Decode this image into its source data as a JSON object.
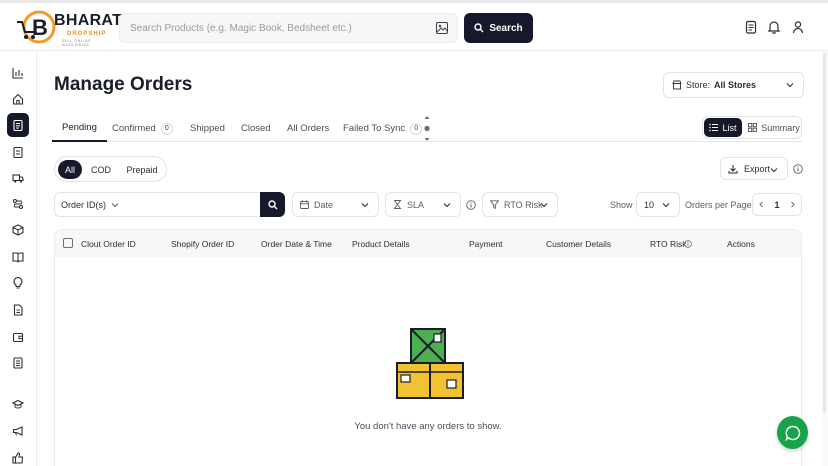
{
  "brand": {
    "name": "BHARAT",
    "sub": "DROPSHIP",
    "tag": "SELL ONLINE WORLDWIDE"
  },
  "search": {
    "placeholder": "Search Products (e.g. Magic Book, Bedsheet etc.)",
    "button_label": "Search"
  },
  "page": {
    "title": "Manage Orders"
  },
  "store": {
    "label": "Store:",
    "value": "All Stores"
  },
  "tabs": [
    {
      "label": "Pending",
      "count": ""
    },
    {
      "label": "Confirmed",
      "count": "0"
    },
    {
      "label": "Shipped",
      "count": ""
    },
    {
      "label": "Closed",
      "count": ""
    },
    {
      "label": "All Orders",
      "count": ""
    },
    {
      "label": "Failed To Sync",
      "count": "0"
    }
  ],
  "view": {
    "list": "List",
    "summary": "Summary"
  },
  "payment_filter": [
    "All",
    "COD",
    "Prepaid"
  ],
  "export_label": "Export",
  "filters": {
    "order_ids": "Order ID(s)",
    "date": "Date",
    "sla": "SLA",
    "rto": "RTO Risk",
    "show_label": "Show",
    "per_page": "10",
    "per_page_label": "Orders per Page",
    "page": "1"
  },
  "table": {
    "columns": [
      "Clout Order ID",
      "Shopify Order ID",
      "Order Date & Time",
      "Product Details",
      "Payment",
      "Customer Details",
      "RTO Risk",
      "Actions"
    ],
    "empty_text": "You don't have any orders to show."
  },
  "colors": {
    "primary": "#15192b",
    "chat": "#17a34a",
    "box_green": "#4caf50",
    "box_yellow": "#f2c233"
  }
}
